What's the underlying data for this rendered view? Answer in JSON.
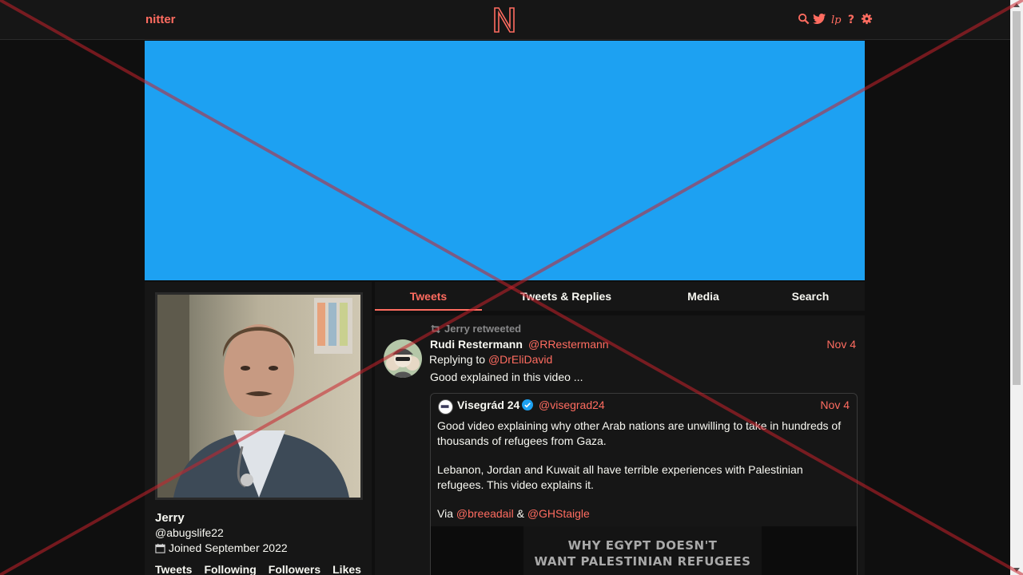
{
  "nav": {
    "brand": "nitter",
    "logo_letter": "N",
    "icons": [
      "search-icon",
      "twitter-bird-icon",
      "rss-icon",
      "help-icon",
      "settings-gear-icon"
    ]
  },
  "colors": {
    "accent": "#ff6c60",
    "banner": "#1da1f2",
    "background": "#0f0f0f",
    "panel": "#161616",
    "overlay_x": "#c8232c"
  },
  "profile": {
    "name": "Jerry",
    "handle": "@abugslife22",
    "joined": "Joined September 2022",
    "stats": [
      "Tweets",
      "Following",
      "Followers",
      "Likes"
    ]
  },
  "tabs": [
    {
      "label": "Tweets",
      "active": true
    },
    {
      "label": "Tweets & Replies",
      "active": false
    },
    {
      "label": "Media",
      "active": false
    },
    {
      "label": "Search",
      "active": false
    }
  ],
  "tweet": {
    "retweet_header": "Jerry retweeted",
    "fullname": "Rudi Restermann",
    "username": "@RRestermann",
    "date": "Nov 4",
    "replying_prefix": "Replying to",
    "replying_to": "@DrEliDavid",
    "text": "Good explained in this video ...",
    "quote": {
      "fullname": "Visegrád 24",
      "username": "@visegrad24",
      "date": "Nov 4",
      "paragraph1": "Good video explaining why other Arab nations are unwilling to take in hundreds of thousands of refugees from Gaza.",
      "paragraph2": "Lebanon, Jordan and Kuwait all have terrible experiences with Palestinian refugees. This video explains it.",
      "via_prefix": "Via",
      "via_link1": "@breeadail",
      "via_amp": "&",
      "via_link2": "@GHStaigle",
      "media_line1": "WHY EGYPT DOESN'T",
      "media_line2": "WANT PALESTINIAN REFUGEES"
    }
  }
}
